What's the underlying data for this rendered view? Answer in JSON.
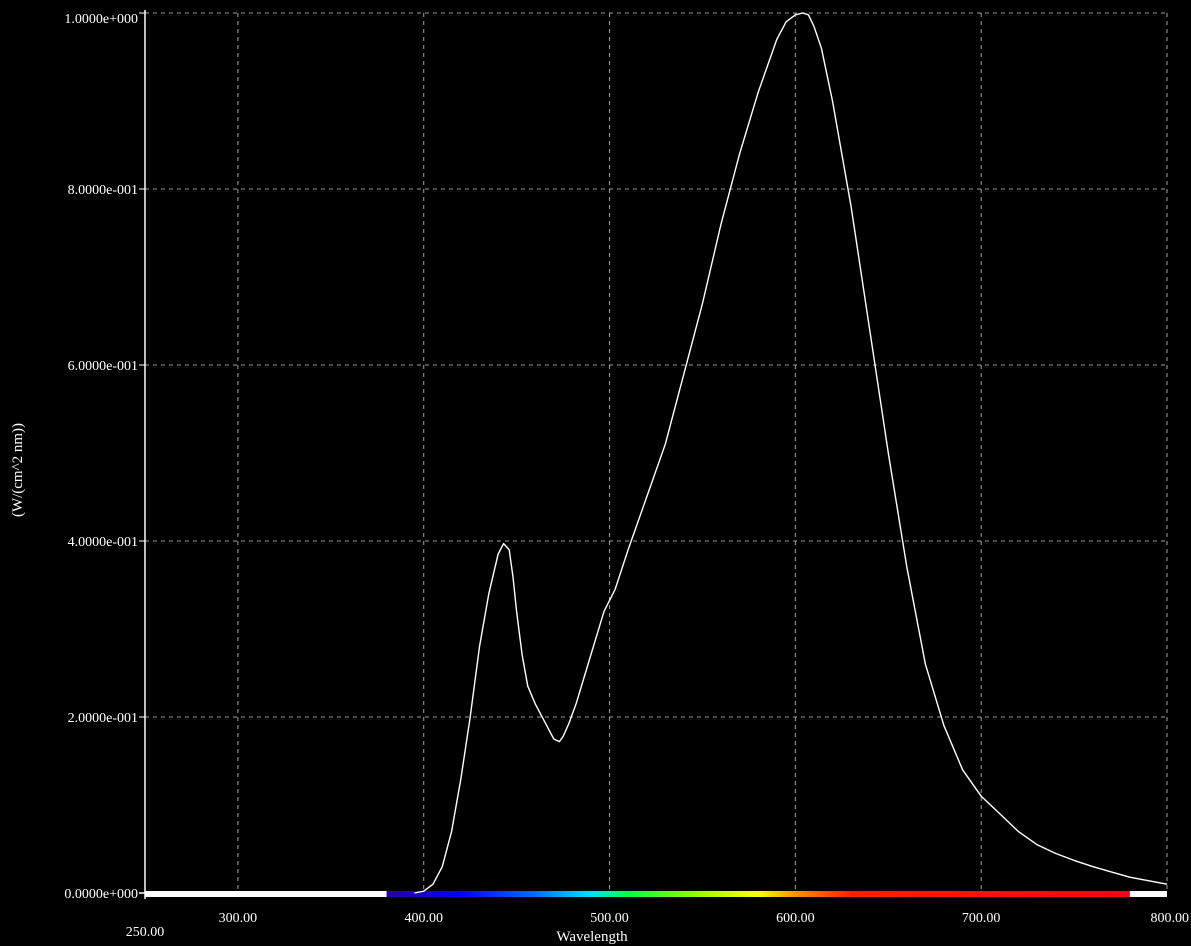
{
  "chart_data": {
    "type": "line",
    "title": "",
    "xlabel": "Wavelength",
    "ylabel": "(W/(cm^2 nm))",
    "xlim": [
      250,
      800
    ],
    "ylim": [
      0,
      1
    ],
    "grid": true,
    "x_ticks": [
      {
        "value": 250,
        "label": "250.00"
      },
      {
        "value": 300,
        "label": "300.00"
      },
      {
        "value": 400,
        "label": "400.00"
      },
      {
        "value": 500,
        "label": "500.00"
      },
      {
        "value": 600,
        "label": "600.00"
      },
      {
        "value": 700,
        "label": "700.00"
      },
      {
        "value": 800,
        "label": "800.00"
      }
    ],
    "y_ticks": [
      {
        "value": 0,
        "label": "0.0000e+000"
      },
      {
        "value": 0.2,
        "label": "2.0000e-001"
      },
      {
        "value": 0.4,
        "label": "4.0000e-001"
      },
      {
        "value": 0.6,
        "label": "6.0000e-001"
      },
      {
        "value": 0.8,
        "label": "8.0000e-001"
      },
      {
        "value": 1.0,
        "label": "1.0000e+000"
      }
    ],
    "spectrum_bar": {
      "range": [
        380,
        780
      ],
      "stops": [
        {
          "wavelength": 380,
          "color": "#2a00a0"
        },
        {
          "wavelength": 420,
          "color": "#0000ff"
        },
        {
          "wavelength": 460,
          "color": "#0070ff"
        },
        {
          "wavelength": 490,
          "color": "#00e0ff"
        },
        {
          "wavelength": 510,
          "color": "#00ff40"
        },
        {
          "wavelength": 550,
          "color": "#a0ff00"
        },
        {
          "wavelength": 580,
          "color": "#ffff00"
        },
        {
          "wavelength": 600,
          "color": "#ff9000"
        },
        {
          "wavelength": 630,
          "color": "#ff2000"
        },
        {
          "wavelength": 780,
          "color": "#ff0000"
        }
      ]
    },
    "colors": {
      "background": "#000000",
      "line": "#ffffff",
      "grid": "#a0a0a0",
      "axis": "#ffffff"
    },
    "series": [
      {
        "x": [
          395,
          400,
          405,
          410,
          415,
          420,
          425,
          430,
          435,
          440,
          443,
          446,
          448,
          450,
          453,
          456,
          460,
          465,
          470,
          473,
          475,
          478,
          482,
          487,
          492,
          497,
          503,
          510,
          520,
          530,
          540,
          550,
          560,
          570,
          580,
          590,
          595,
          600,
          604,
          607,
          610,
          614,
          620,
          630,
          640,
          650,
          660,
          670,
          680,
          690,
          700,
          710,
          720,
          730,
          740,
          750,
          760,
          770,
          780,
          790,
          800
        ],
        "y": [
          0.0,
          0.002,
          0.01,
          0.03,
          0.07,
          0.13,
          0.2,
          0.28,
          0.34,
          0.385,
          0.397,
          0.39,
          0.36,
          0.32,
          0.27,
          0.235,
          0.215,
          0.195,
          0.175,
          0.172,
          0.178,
          0.192,
          0.215,
          0.25,
          0.285,
          0.32,
          0.345,
          0.39,
          0.45,
          0.51,
          0.59,
          0.67,
          0.76,
          0.84,
          0.91,
          0.97,
          0.99,
          0.998,
          1.0,
          0.998,
          0.985,
          0.96,
          0.9,
          0.78,
          0.64,
          0.5,
          0.37,
          0.26,
          0.19,
          0.14,
          0.11,
          0.09,
          0.07,
          0.055,
          0.045,
          0.037,
          0.03,
          0.024,
          0.018,
          0.014,
          0.01
        ]
      }
    ]
  }
}
